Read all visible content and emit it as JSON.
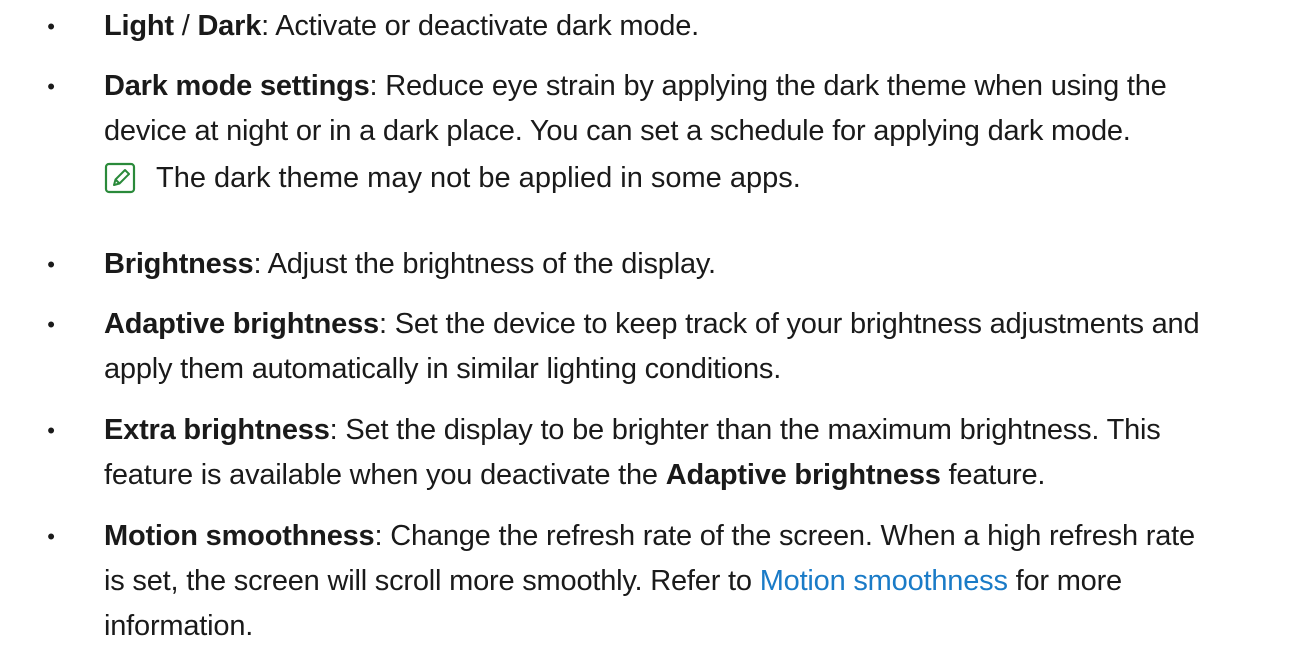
{
  "items": [
    {
      "bold": "Light",
      "sep": " / ",
      "bold2": "Dark",
      "rest": ": Activate or deactivate dark mode."
    },
    {
      "bold": "Dark mode settings",
      "line1": ": Reduce eye strain by applying the dark theme when using the",
      "line2": "device at night or in a dark place. You can set a schedule for applying dark mode."
    },
    {
      "bold": "Brightness",
      "rest": ": Adjust the brightness of the display."
    },
    {
      "bold": "Adaptive brightness",
      "line1": ": Set the device to keep track of your brightness adjustments and",
      "line2": "apply them automatically in similar lighting conditions."
    },
    {
      "bold": "Extra brightness",
      "line1": ": Set the display to be brighter than the maximum brightness. This",
      "line2_pre": "feature is available when you deactivate the ",
      "line2_bold": "Adaptive brightness",
      "line2_post": " feature."
    },
    {
      "bold": "Motion smoothness",
      "line1": ": Change the refresh rate of the screen. When a high refresh rate",
      "line2_pre": "is set, the screen will scroll more smoothly. Refer to ",
      "line2_link": "Motion smoothness",
      "line2_post": " for more",
      "line3": "information."
    }
  ],
  "note": {
    "icon": "note-pencil-icon",
    "text": "The dark theme may not be applied in some apps."
  },
  "colors": {
    "text": "#1a1a1a",
    "link": "#1a7bc7",
    "icon": "#2a8a3a"
  }
}
